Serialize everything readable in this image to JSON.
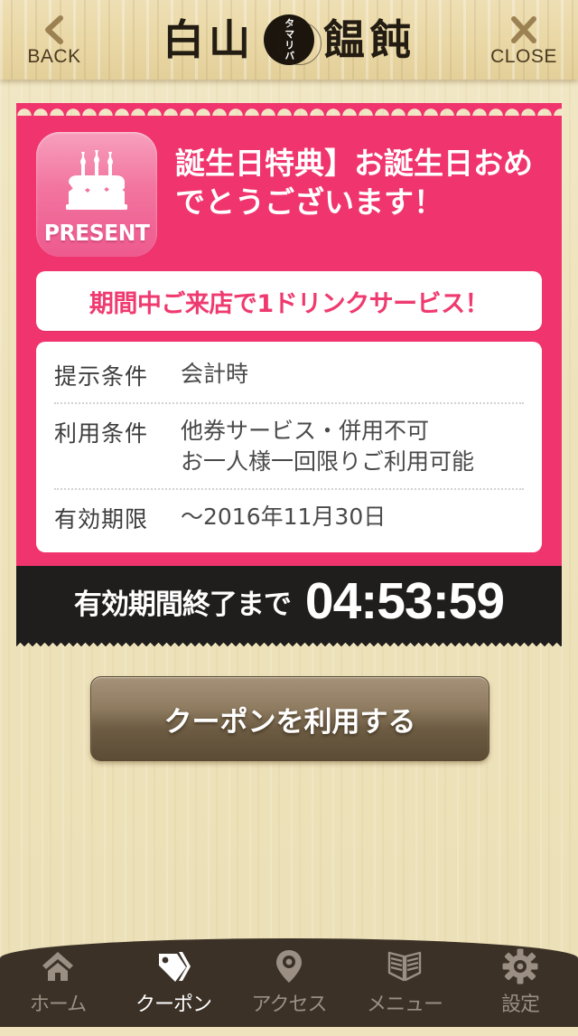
{
  "header": {
    "back_label": "BACK",
    "close_label": "CLOSE",
    "title_left": "白山",
    "title_right": "饂飩",
    "brand_seal": "タマリバ"
  },
  "coupon": {
    "badge_icon": "birthday-cake-icon",
    "badge_word": "PRESENT",
    "title": "誕生日特典】お誕生日おめでとうございます！",
    "headline": "期間中ご来店で1ドリンクサービス！",
    "details": [
      {
        "label": "提示条件",
        "value": "会計時"
      },
      {
        "label": "利用条件",
        "value": "他券サービス・併用不可\nお一人様一回限りご利用可能"
      },
      {
        "label": "有効期限",
        "value": "～2016年11月30日"
      }
    ]
  },
  "countdown": {
    "label": "有効期間終了まで",
    "time": "04:53:59"
  },
  "action": {
    "use_coupon_label": "クーポンを利用する"
  },
  "tabbar": {
    "items": [
      {
        "label": "ホーム",
        "icon": "home-icon",
        "active": false
      },
      {
        "label": "クーポン",
        "icon": "tag-icon",
        "active": true
      },
      {
        "label": "アクセス",
        "icon": "map-pin-icon",
        "active": false
      },
      {
        "label": "メニュー",
        "icon": "book-icon",
        "active": false
      },
      {
        "label": "設定",
        "icon": "gear-icon",
        "active": false
      }
    ]
  },
  "colors": {
    "accent_pink": "#f0346d",
    "countdown_bg": "#201e1c",
    "tabbar_bg": "#3b3127",
    "wood_bg": "#efe3bd",
    "button_brown": "#6d5c43"
  }
}
